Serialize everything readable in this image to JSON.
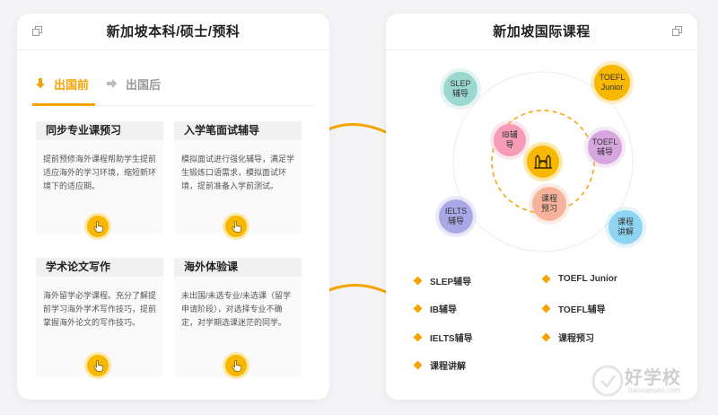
{
  "left_panel": {
    "title": "新加坡本科/硕士/预科",
    "tabs": [
      {
        "label": "出国前",
        "active": true
      },
      {
        "label": "出国后",
        "active": false
      }
    ],
    "cards": [
      {
        "title": "同步专业课预习",
        "body": "提前预修海外课程帮助学生提前适应海外的学习环境，缩短新环境下的适应期。"
      },
      {
        "title": "入学笔面试辅导",
        "body": "模拟面试进行强化辅导，满足学生锻炼口语需求，模拟面试环境，提前准备入学前测试。"
      },
      {
        "title": "学术论文写作",
        "body": "海外留学必学课程。充分了解提前学习海外学术写作技巧，提前掌握海外论文的写作技巧。"
      },
      {
        "title": "海外体验课",
        "body": "未出国/未选专业/未选课（留学申请阶段），对选择专业不确定，对学期选课迷茫的同学。"
      }
    ]
  },
  "right_panel": {
    "title": "新加坡国际课程",
    "bubbles": [
      {
        "label": "SLEP\n辅导",
        "color": "#9bd8cf"
      },
      {
        "label": "TOEFL\nJunior",
        "color": "#f9b800"
      },
      {
        "label": "IB辅\n导",
        "color": "#f79bb6"
      },
      {
        "label": "TOEFL\n辅导",
        "color": "#d7a6df"
      },
      {
        "label": "IELTS\n辅导",
        "color": "#a9a7e6"
      },
      {
        "label": "课程\n预习",
        "color": "#f7b39a"
      },
      {
        "label": "课程\n讲解",
        "color": "#8fd5f1"
      }
    ],
    "legend": [
      "SLEP辅导",
      "TOEFL Junior",
      "IB辅导",
      "TOEFL辅导",
      "IELTS辅导",
      "课程预习",
      "课程讲解"
    ]
  },
  "watermark": {
    "label": "好学校",
    "sub": "haoxuexiao.com"
  },
  "colors": {
    "accent": "#f5a300",
    "button": "#f9b800"
  }
}
